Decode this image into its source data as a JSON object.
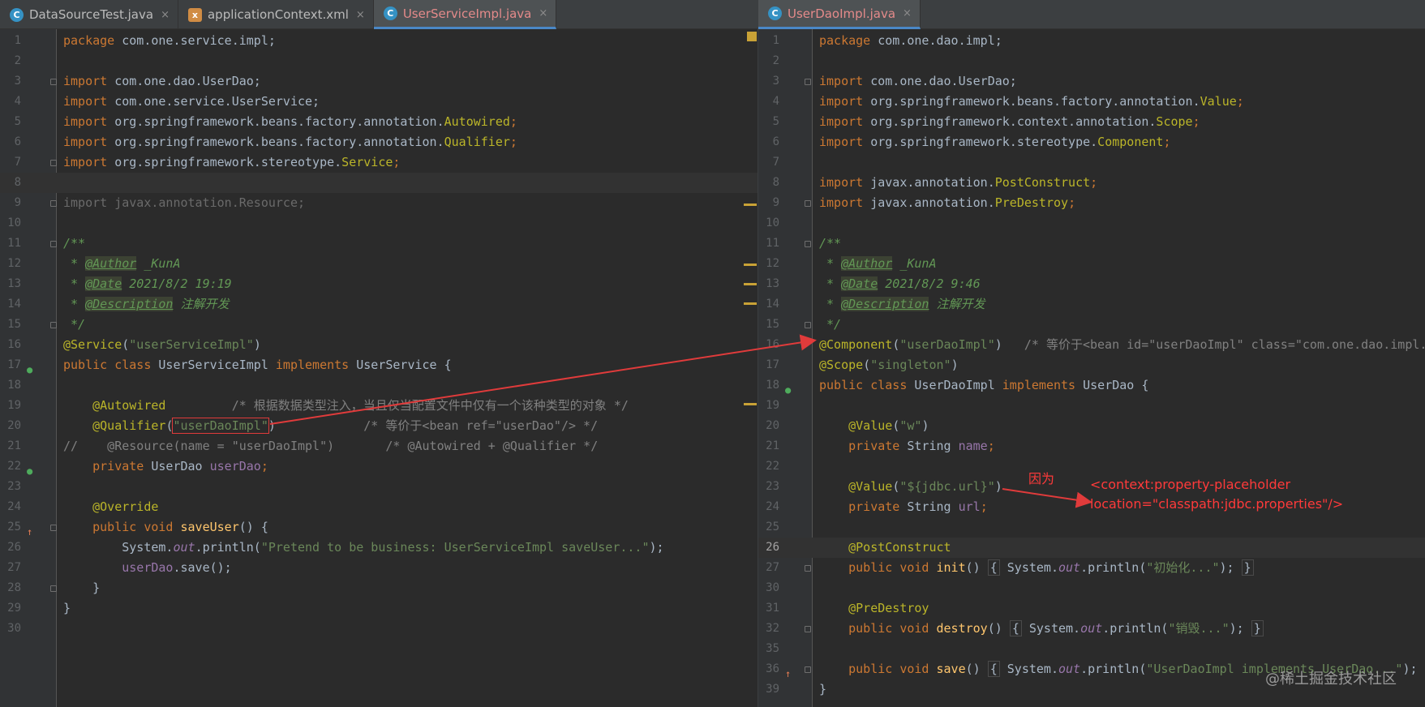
{
  "left_tabs": [
    {
      "label": "DataSourceTest.java",
      "icon": "java-class-icon",
      "close": "×"
    },
    {
      "label": "applicationContext.xml",
      "icon": "xml-file-icon",
      "close": "×"
    },
    {
      "label": "UserServiceImpl.java",
      "icon": "java-class-icon",
      "close": "×",
      "active": true
    }
  ],
  "right_tabs": [
    {
      "label": "UserDaoImpl.java",
      "icon": "java-class-icon",
      "close": "×",
      "active": true
    }
  ],
  "left_line_numbers": [
    "1",
    "2",
    "3",
    "4",
    "5",
    "6",
    "7",
    "8",
    "9",
    "10",
    "11",
    "12",
    "13",
    "14",
    "15",
    "16",
    "17",
    "18",
    "19",
    "20",
    "21",
    "22",
    "23",
    "24",
    "25",
    "26",
    "27",
    "28",
    "29",
    "30"
  ],
  "right_line_numbers": [
    "1",
    "2",
    "3",
    "4",
    "5",
    "6",
    "7",
    "8",
    "9",
    "10",
    "11",
    "12",
    "13",
    "14",
    "15",
    "16",
    "17",
    "18",
    "19",
    "20",
    "21",
    "22",
    "23",
    "24",
    "25",
    "26",
    "27",
    "30",
    "31",
    "32",
    "35",
    "36",
    "39"
  ],
  "left_code": {
    "l1": [
      "package",
      " com.one.service.impl;"
    ],
    "l3": [
      "import",
      " com.one.dao.UserDao;"
    ],
    "l4": [
      "import",
      " com.one.service.UserService;"
    ],
    "l5": [
      "import",
      " org.springframework.beans.factory.annotation.",
      "Autowired",
      ";"
    ],
    "l6": [
      "import",
      " org.springframework.beans.factory.annotation.",
      "Qualifier",
      ";"
    ],
    "l7": [
      "import",
      " org.springframework.stereotype.",
      "Service",
      ";"
    ],
    "l9": "import javax.annotation.Resource;",
    "l11": "/**",
    "l12": [
      " * ",
      "@Author",
      " _KunA"
    ],
    "l13": [
      " * ",
      "@Date",
      " 2021/8/2 19:19"
    ],
    "l14": [
      " * ",
      "@Description",
      " 注解开发"
    ],
    "l15": " */",
    "l16": [
      "@Service",
      "(",
      "\"userServiceImpl\"",
      ")"
    ],
    "l17": [
      "public class",
      " UserServiceImpl ",
      "implements",
      " UserService {"
    ],
    "l19": [
      "    ",
      "@Autowired",
      "         /* 根据数据类型注入，当且仅当配置文件中仅有一个该种类型的对象 */"
    ],
    "l20": [
      "    ",
      "@Qualifier",
      "(",
      "\"userDaoImpl\"",
      ")",
      "            /* 等价于<bean ref=\"userDao\"/> */"
    ],
    "l21": "//    @Resource(name = \"userDaoImpl\")       /* @Autowired + @Qualifier */",
    "l22": [
      "    ",
      "private",
      " UserDao ",
      "userDao",
      ";"
    ],
    "l24": [
      "    ",
      "@Override"
    ],
    "l25": [
      "    ",
      "public void",
      " ",
      "saveUser",
      "() {"
    ],
    "l26": [
      "        System.",
      "out",
      ".println(",
      "\"Pretend to be business: UserServiceImpl saveUser...\"",
      ");"
    ],
    "l27": [
      "        ",
      "userDao",
      ".save();"
    ],
    "l28": "    }",
    "l29": "}"
  },
  "right_code": {
    "l1": [
      "package",
      " com.one.dao.impl;"
    ],
    "l3": [
      "import",
      " com.one.dao.UserDao;"
    ],
    "l4": [
      "import",
      " org.springframework.beans.factory.annotation.",
      "Value",
      ";"
    ],
    "l5": [
      "import",
      " org.springframework.context.annotation.",
      "Scope",
      ";"
    ],
    "l6": [
      "import",
      " org.springframework.stereotype.",
      "Component",
      ";"
    ],
    "l8": [
      "import",
      " javax.annotation.",
      "PostConstruct",
      ";"
    ],
    "l9": [
      "import",
      " javax.annotation.",
      "PreDestroy",
      ";"
    ],
    "l11": "/**",
    "l12": [
      " * ",
      "@Author",
      " _KunA"
    ],
    "l13": [
      " * ",
      "@Date",
      " 2021/8/2 9:46"
    ],
    "l14": [
      " * ",
      "@Description",
      " 注解开发"
    ],
    "l15": " */",
    "l16": [
      "@Component",
      "(",
      "\"userDaoImpl\"",
      ")",
      "   /* 等价于<bean id=\"userDaoImpl\" class=\"com.one.dao.impl.UserDaoImpl\"/> */"
    ],
    "l17": [
      "@Scope",
      "(",
      "\"singleton\"",
      ")"
    ],
    "l18": [
      "public class",
      " UserDaoImpl ",
      "implements",
      " UserDao {"
    ],
    "l20": [
      "    ",
      "@Value",
      "(",
      "\"w\"",
      ")"
    ],
    "l21": [
      "    ",
      "private",
      " String ",
      "name",
      ";"
    ],
    "l23": [
      "    ",
      "@Value",
      "(",
      "\"${jdbc.url}\"",
      ")"
    ],
    "l24": [
      "    ",
      "private",
      " String ",
      "url",
      ";"
    ],
    "l26": [
      "    ",
      "@PostConstruct"
    ],
    "l27": [
      "    ",
      "public void",
      " ",
      "init",
      "() ",
      "{",
      " System.",
      "out",
      ".println(",
      "\"初始化...\"",
      "); ",
      "}"
    ],
    "l31": [
      "    ",
      "@PreDestroy"
    ],
    "l32": [
      "    ",
      "public void",
      " ",
      "destroy",
      "() ",
      "{",
      " System.",
      "out",
      ".println(",
      "\"销毁...\"",
      "); ",
      "}"
    ],
    "l36": [
      "    ",
      "public void",
      " ",
      "save",
      "() ",
      "{",
      " System.",
      "out",
      ".println(",
      "\"UserDaoImpl implements UserDao...\"",
      "); ",
      "}"
    ],
    "l39": "}"
  },
  "annotations": {
    "because": "因为",
    "placeholder_line1": "<context:property-placeholder",
    "placeholder_line2": "location=\"classpath:jdbc.properties\"/>"
  },
  "watermark": "@稀土掘金技术社区",
  "colors": {
    "background": "#2b2b2b",
    "keyword": "#cc7832",
    "annotation": "#bbb529",
    "string": "#6a8759",
    "comment": "#808080",
    "doc_comment": "#629755",
    "field": "#9876aa",
    "method": "#ffc66d",
    "arrow": "#e03b3b"
  }
}
